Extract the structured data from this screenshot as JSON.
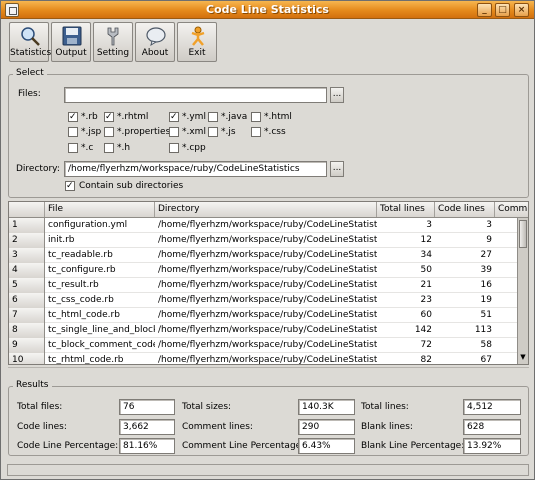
{
  "window": {
    "title": "Code Line Statistics"
  },
  "toolbar": {
    "statistics": "Statistics",
    "output": "Output",
    "setting": "Setting",
    "about": "About",
    "exit": "Exit"
  },
  "select": {
    "title": "Select",
    "files_label": "Files:",
    "files_value": "",
    "browse": "...",
    "directory_label": "Directory:",
    "directory_value": "/home/flyerhzm/workspace/ruby/CodeLineStatistics",
    "contain_sub": "Contain sub directories",
    "extensions": [
      {
        "label": "*.rb",
        "checked": true
      },
      {
        "label": "*.rhtml",
        "checked": true
      },
      {
        "label": "*.yml",
        "checked": true
      },
      {
        "label": "*.java",
        "checked": false
      },
      {
        "label": "*.html",
        "checked": false
      },
      {
        "label": "*.jsp",
        "checked": false
      },
      {
        "label": "*.properties",
        "checked": false
      },
      {
        "label": "*.xml",
        "checked": false
      },
      {
        "label": "*.js",
        "checked": false
      },
      {
        "label": "*.css",
        "checked": false
      },
      {
        "label": "*.c",
        "checked": false
      },
      {
        "label": "*.h",
        "checked": false
      },
      {
        "label": "*.cpp",
        "checked": false
      }
    ]
  },
  "table": {
    "headers": [
      "File",
      "Directory",
      "Total lines",
      "Code lines",
      "Comm"
    ],
    "rows": [
      {
        "n": "1",
        "file": "configuration.yml",
        "dir": "/home/flyerhzm/workspace/ruby/CodeLineStatistics/pl",
        "total": "3",
        "code": "3"
      },
      {
        "n": "2",
        "file": "init.rb",
        "dir": "/home/flyerhzm/workspace/ruby/CodeLineStatistics/pl",
        "total": "12",
        "code": "9"
      },
      {
        "n": "3",
        "file": "tc_readable.rb",
        "dir": "/home/flyerhzm/workspace/ruby/CodeLineStatistics/pl",
        "total": "34",
        "code": "27"
      },
      {
        "n": "4",
        "file": "tc_configure.rb",
        "dir": "/home/flyerhzm/workspace/ruby/CodeLineStatistics/pl",
        "total": "50",
        "code": "39"
      },
      {
        "n": "5",
        "file": "tc_result.rb",
        "dir": "/home/flyerhzm/workspace/ruby/CodeLineStatistics/pl",
        "total": "21",
        "code": "16"
      },
      {
        "n": "6",
        "file": "tc_css_code.rb",
        "dir": "/home/flyerhzm/workspace/ruby/CodeLineStatistics/pl",
        "total": "23",
        "code": "19"
      },
      {
        "n": "7",
        "file": "tc_html_code.rb",
        "dir": "/home/flyerhzm/workspace/ruby/CodeLineStatistics/pl",
        "total": "60",
        "code": "51"
      },
      {
        "n": "8",
        "file": "tc_single_line_and_block_",
        "dir": "/home/flyerhzm/workspace/ruby/CodeLineStatistics/pl",
        "total": "142",
        "code": "113"
      },
      {
        "n": "9",
        "file": "tc_block_comment_code.rl",
        "dir": "/home/flyerhzm/workspace/ruby/CodeLineStatistics/pl",
        "total": "72",
        "code": "58"
      },
      {
        "n": "10",
        "file": "tc_rhtml_code.rb",
        "dir": "/home/flyerhzm/workspace/ruby/CodeLineStatistics/pl",
        "total": "82",
        "code": "67"
      }
    ]
  },
  "results": {
    "title": "Results",
    "total_files_label": "Total files:",
    "total_files": "76",
    "total_sizes_label": "Total sizes:",
    "total_sizes": "140.3K",
    "total_lines_label": "Total lines:",
    "total_lines": "4,512",
    "code_lines_label": "Code lines:",
    "code_lines": "3,662",
    "comment_lines_label": "Comment lines:",
    "comment_lines": "290",
    "blank_lines_label": "Blank lines:",
    "blank_lines": "628",
    "code_pct_label": "Code Line Percentage:",
    "code_pct": "81.16%",
    "comment_pct_label": "Comment Line Percentage:",
    "comment_pct": "6.43%",
    "blank_pct_label": "Blank Line Percentage:",
    "blank_pct": "13.92%"
  }
}
